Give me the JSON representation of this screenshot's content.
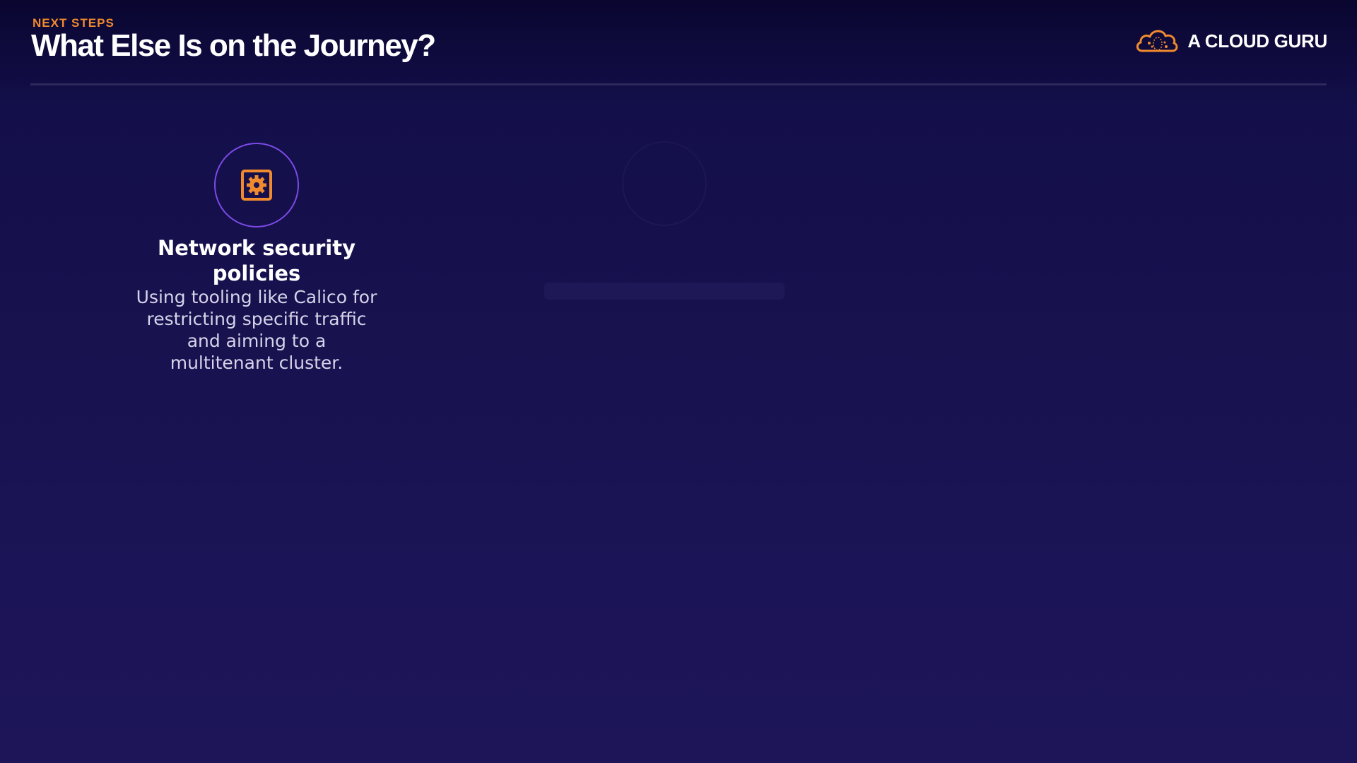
{
  "header": {
    "eyebrow": "NEXT STEPS",
    "title": "What Else Is on the Journey?"
  },
  "brand": {
    "name": "A CLOUD GURU",
    "logo_icon": "cloud-logo-icon",
    "logo_color": "#f08a2e"
  },
  "cards": [
    {
      "icon": "gear-in-square-icon",
      "icon_color": "#f08a2e",
      "ring_color": "#7b4ae6",
      "title": "Network security policies",
      "description": "Using tooling like Calico for restricting specific traffic and aiming to a multitenant cluster."
    }
  ],
  "colors": {
    "accent": "#f08a2e",
    "background_top": "#0a0630",
    "background_bottom": "#1d1558"
  }
}
